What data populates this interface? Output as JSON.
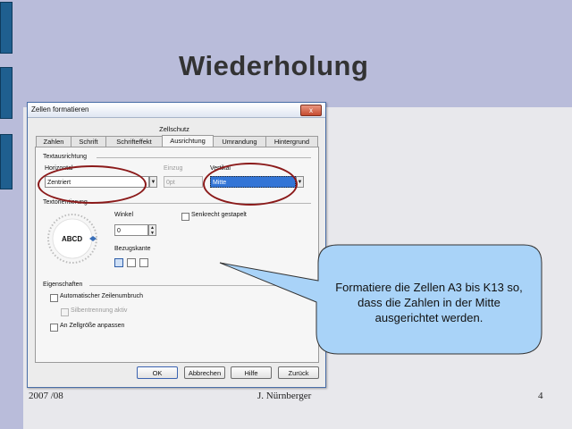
{
  "slide": {
    "title": "Wiederholung",
    "footer_left": "2007 /08",
    "footer_center": "J. Nürnberger",
    "footer_right": "4",
    "callout_text": "Formatiere die Zellen A3 bis K13 so, dass die Zahlen in der Mitte ausgerichtet werden."
  },
  "dialog": {
    "title": "Zellen formatieren",
    "close_label": "x",
    "tab_top": "Zellschutz",
    "tabs": [
      "Zahlen",
      "Schrift",
      "Schrifteffekt",
      "Ausrichtung",
      "Umrandung",
      "Hintergrund"
    ],
    "active_tab": "Ausrichtung",
    "section_textausrichtung": "Textausrichtung",
    "horizontal_label": "Horizontal",
    "horizontal_value": "Zentriert",
    "einzug_label": "Einzug",
    "einzug_value": "0pt",
    "vertikal_label": "Vertikal",
    "vertikal_value": "Mitte",
    "section_textorientierung": "Textorientierung",
    "dial_text": "ABCD",
    "winkel_label": "Winkel",
    "winkel_value": "0",
    "senkrecht_label": "Senkrecht gestapelt",
    "bezugskante_label": "Bezugskante",
    "section_eigenschaften": "Eigenschaften",
    "auto_umbruch_label": "Automatischer Zeilenumbruch",
    "silbentrennung_label": "Silbentrennung aktiv",
    "zellgroesse_label": "An Zellgröße anpassen",
    "buttons": {
      "ok": "OK",
      "abbrechen": "Abbrechen",
      "hilfe": "Hilfe",
      "zurueck": "Zurück"
    }
  },
  "colors": {
    "slide_bg": "#b9bcda",
    "bar": "#1f5f8f",
    "callout_fill": "#a9d3f8",
    "highlight": "#8b1a1a"
  }
}
